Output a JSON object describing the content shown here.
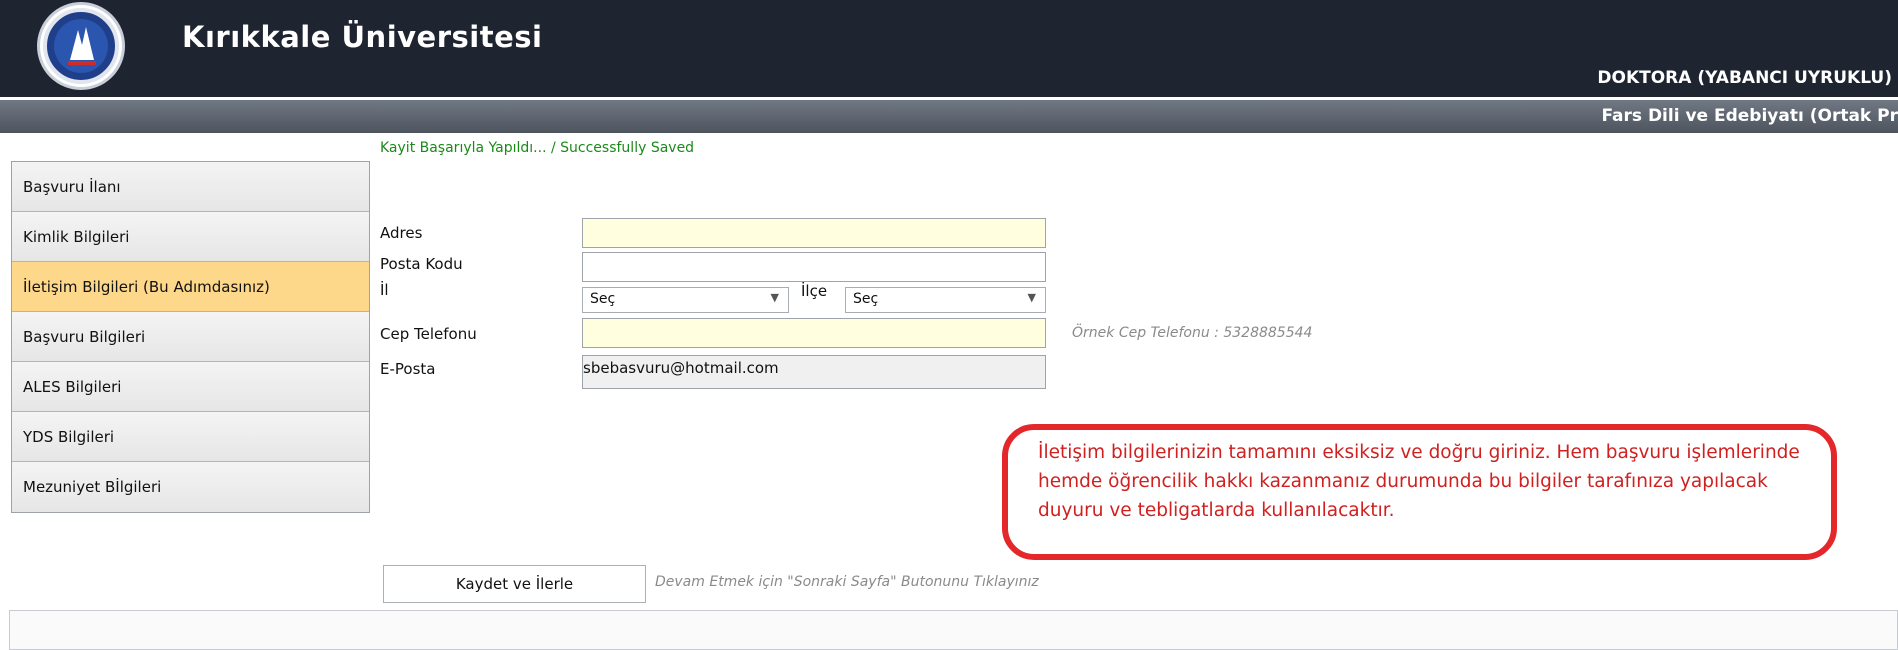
{
  "header": {
    "university": "Kırıkkale Üniversitesi",
    "program": "DOKTORA (YABANCI UYRUKLU)",
    "department": "Fars Dili ve Edebiyatı (Ortak Pr",
    "logo_icon": "university-seal-icon"
  },
  "status": {
    "message": "Kayit Başarıyla Yapıldı... / Successfully Saved",
    "color": "#1a8a1a"
  },
  "sidebar": {
    "items": [
      {
        "label": "Başvuru İlanı",
        "active": false
      },
      {
        "label": "Kimlik Bilgileri",
        "active": false
      },
      {
        "label": "İletişim Bilgileri (Bu Adımdasınız)",
        "active": true
      },
      {
        "label": "Başvuru Bilgileri",
        "active": false
      },
      {
        "label": "ALES Bilgileri",
        "active": false
      },
      {
        "label": "YDS Bilgileri",
        "active": false
      },
      {
        "label": "Mezuniyet Bİlgileri",
        "active": false
      }
    ],
    "active_color": "#fdd88a"
  },
  "form": {
    "address_label": "Adres",
    "address_value": "",
    "postal_label": "Posta Kodu",
    "postal_value": "",
    "province_label": "İl",
    "province_value": "Seç",
    "district_label": "İlçe",
    "district_value": "Seç",
    "phone_label": "Cep Telefonu",
    "phone_value": "",
    "phone_hint": "Örnek Cep Telefonu : 5328885544",
    "email_label": "E-Posta",
    "email_value": "sbebasvuru@hotmail.com"
  },
  "notice": {
    "text": "İletişim bilgilerinizin tamamını eksiksiz ve doğru giriniz. Hem başvuru işlemlerinde hemde öğrencilik hakkı kazanmanız durumunda bu bilgiler tarafınıza yapılacak duyuru ve tebligatlarda kullanılacaktır.",
    "color": "#d12020"
  },
  "actions": {
    "save_label": "Kaydet ve İlerle",
    "save_hint": "Devam Etmek için \"Sonraki Sayfa\" Butonunu Tıklayınız"
  }
}
